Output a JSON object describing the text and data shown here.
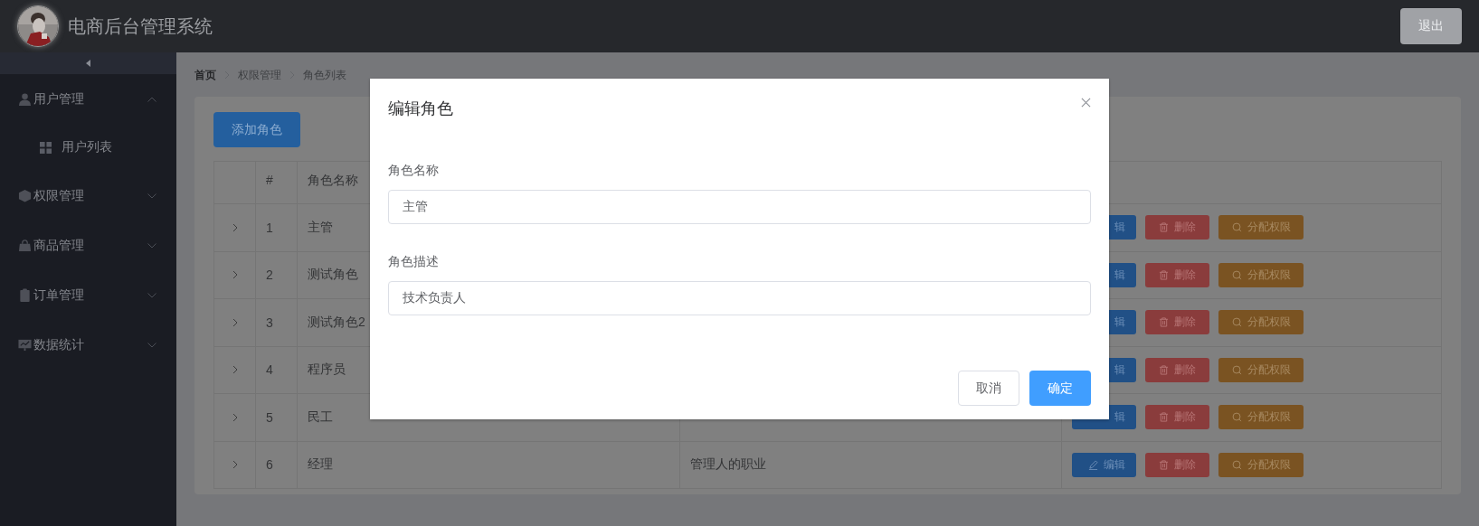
{
  "header": {
    "title": "电商后台管理系统",
    "logout": "退出"
  },
  "sidebar": {
    "items": [
      {
        "label": "用户管理",
        "expanded": true,
        "children": [
          {
            "label": "用户列表"
          }
        ]
      },
      {
        "label": "权限管理",
        "expanded": false
      },
      {
        "label": "商品管理",
        "expanded": false
      },
      {
        "label": "订单管理",
        "expanded": false
      },
      {
        "label": "数据统计",
        "expanded": false
      }
    ]
  },
  "breadcrumb": [
    "首页",
    "权限管理",
    "角色列表"
  ],
  "add_button": "添加角色",
  "table": {
    "columns": [
      "#",
      "角色名称"
    ],
    "rows": [
      {
        "index": "1",
        "name": "主管",
        "actions": [
          {
            "kind": "edit_clipped",
            "label": "辑"
          },
          {
            "kind": "delete",
            "label": "删除"
          },
          {
            "kind": "assign",
            "label": "分配权限"
          }
        ]
      },
      {
        "index": "2",
        "name": "测试角色",
        "actions": [
          {
            "kind": "edit_clipped",
            "label": "辑"
          },
          {
            "kind": "delete",
            "label": "删除"
          },
          {
            "kind": "assign",
            "label": "分配权限"
          }
        ]
      },
      {
        "index": "3",
        "name": "测试角色2",
        "actions": [
          {
            "kind": "edit_clipped",
            "label": "辑"
          },
          {
            "kind": "delete",
            "label": "删除"
          },
          {
            "kind": "assign",
            "label": "分配权限"
          }
        ]
      },
      {
        "index": "4",
        "name": "程序员",
        "actions": [
          {
            "kind": "edit_clipped",
            "label": "辑"
          },
          {
            "kind": "delete",
            "label": "删除"
          },
          {
            "kind": "assign",
            "label": "分配权限"
          }
        ]
      },
      {
        "index": "5",
        "name": "民工",
        "actions": [
          {
            "kind": "edit_clipped",
            "label": "辑"
          },
          {
            "kind": "delete",
            "label": "删除"
          },
          {
            "kind": "assign",
            "label": "分配权限"
          }
        ]
      },
      {
        "index": "6",
        "name": "经理",
        "description": "管理人的职业",
        "actions": [
          {
            "kind": "edit",
            "label": "编辑"
          },
          {
            "kind": "delete",
            "label": "删除"
          },
          {
            "kind": "assign",
            "label": "分配权限"
          }
        ]
      }
    ]
  },
  "dialog": {
    "title": "编辑角色",
    "fields": [
      {
        "label": "角色名称",
        "value": "主管"
      },
      {
        "label": "角色描述",
        "value": "技术负责人"
      }
    ],
    "cancel": "取消",
    "confirm": "确定"
  }
}
